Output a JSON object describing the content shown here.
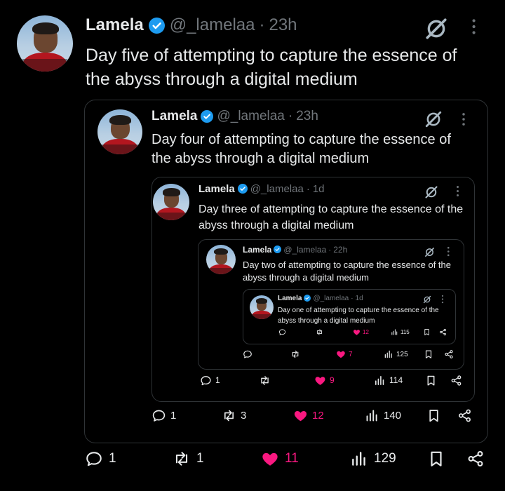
{
  "tweets": [
    {
      "name": "Lamela",
      "handle": "@_lamelaa",
      "time": "23h",
      "text": "Day five of attempting to capture the essence of the abyss through a digital medium",
      "replies": "1",
      "retweets": "1",
      "likes": "11",
      "views": "129"
    },
    {
      "name": "Lamela",
      "handle": "@_lamelaa",
      "time": "23h",
      "text": "Day four of attempting to capture the essence of the abyss through a digital medium",
      "replies": "1",
      "retweets": "3",
      "likes": "12",
      "views": "140"
    },
    {
      "name": "Lamela",
      "handle": "@_lamelaa",
      "time": "1d",
      "text": "Day three of attempting to capture the essence of the abyss through a digital medium",
      "replies": "1",
      "retweets": "",
      "likes": "9",
      "views": "114"
    },
    {
      "name": "Lamela",
      "handle": "@_lamelaa",
      "time": "22h",
      "text": "Day two of attempting to capture the essence of the abyss through a digital medium",
      "replies": "",
      "retweets": "",
      "likes": "7",
      "views": "125"
    },
    {
      "name": "Lamela",
      "handle": "@_lamelaa",
      "time": "1d",
      "text": "Day one of attempting to capture the essence of the abyss through a digital medium",
      "replies": "",
      "retweets": "",
      "likes": "12",
      "views": "115"
    }
  ],
  "separator": "·",
  "colors": {
    "background": "#000000",
    "text": "#e7e9ea",
    "muted": "#71767b",
    "like": "#f91880",
    "verified": "#1d9bf0",
    "border": "#2f3336"
  },
  "icons": [
    "verified-badge-icon",
    "grok-icon",
    "more-icon",
    "reply-icon",
    "retweet-icon",
    "heart-icon",
    "views-icon",
    "bookmark-icon",
    "share-icon"
  ]
}
